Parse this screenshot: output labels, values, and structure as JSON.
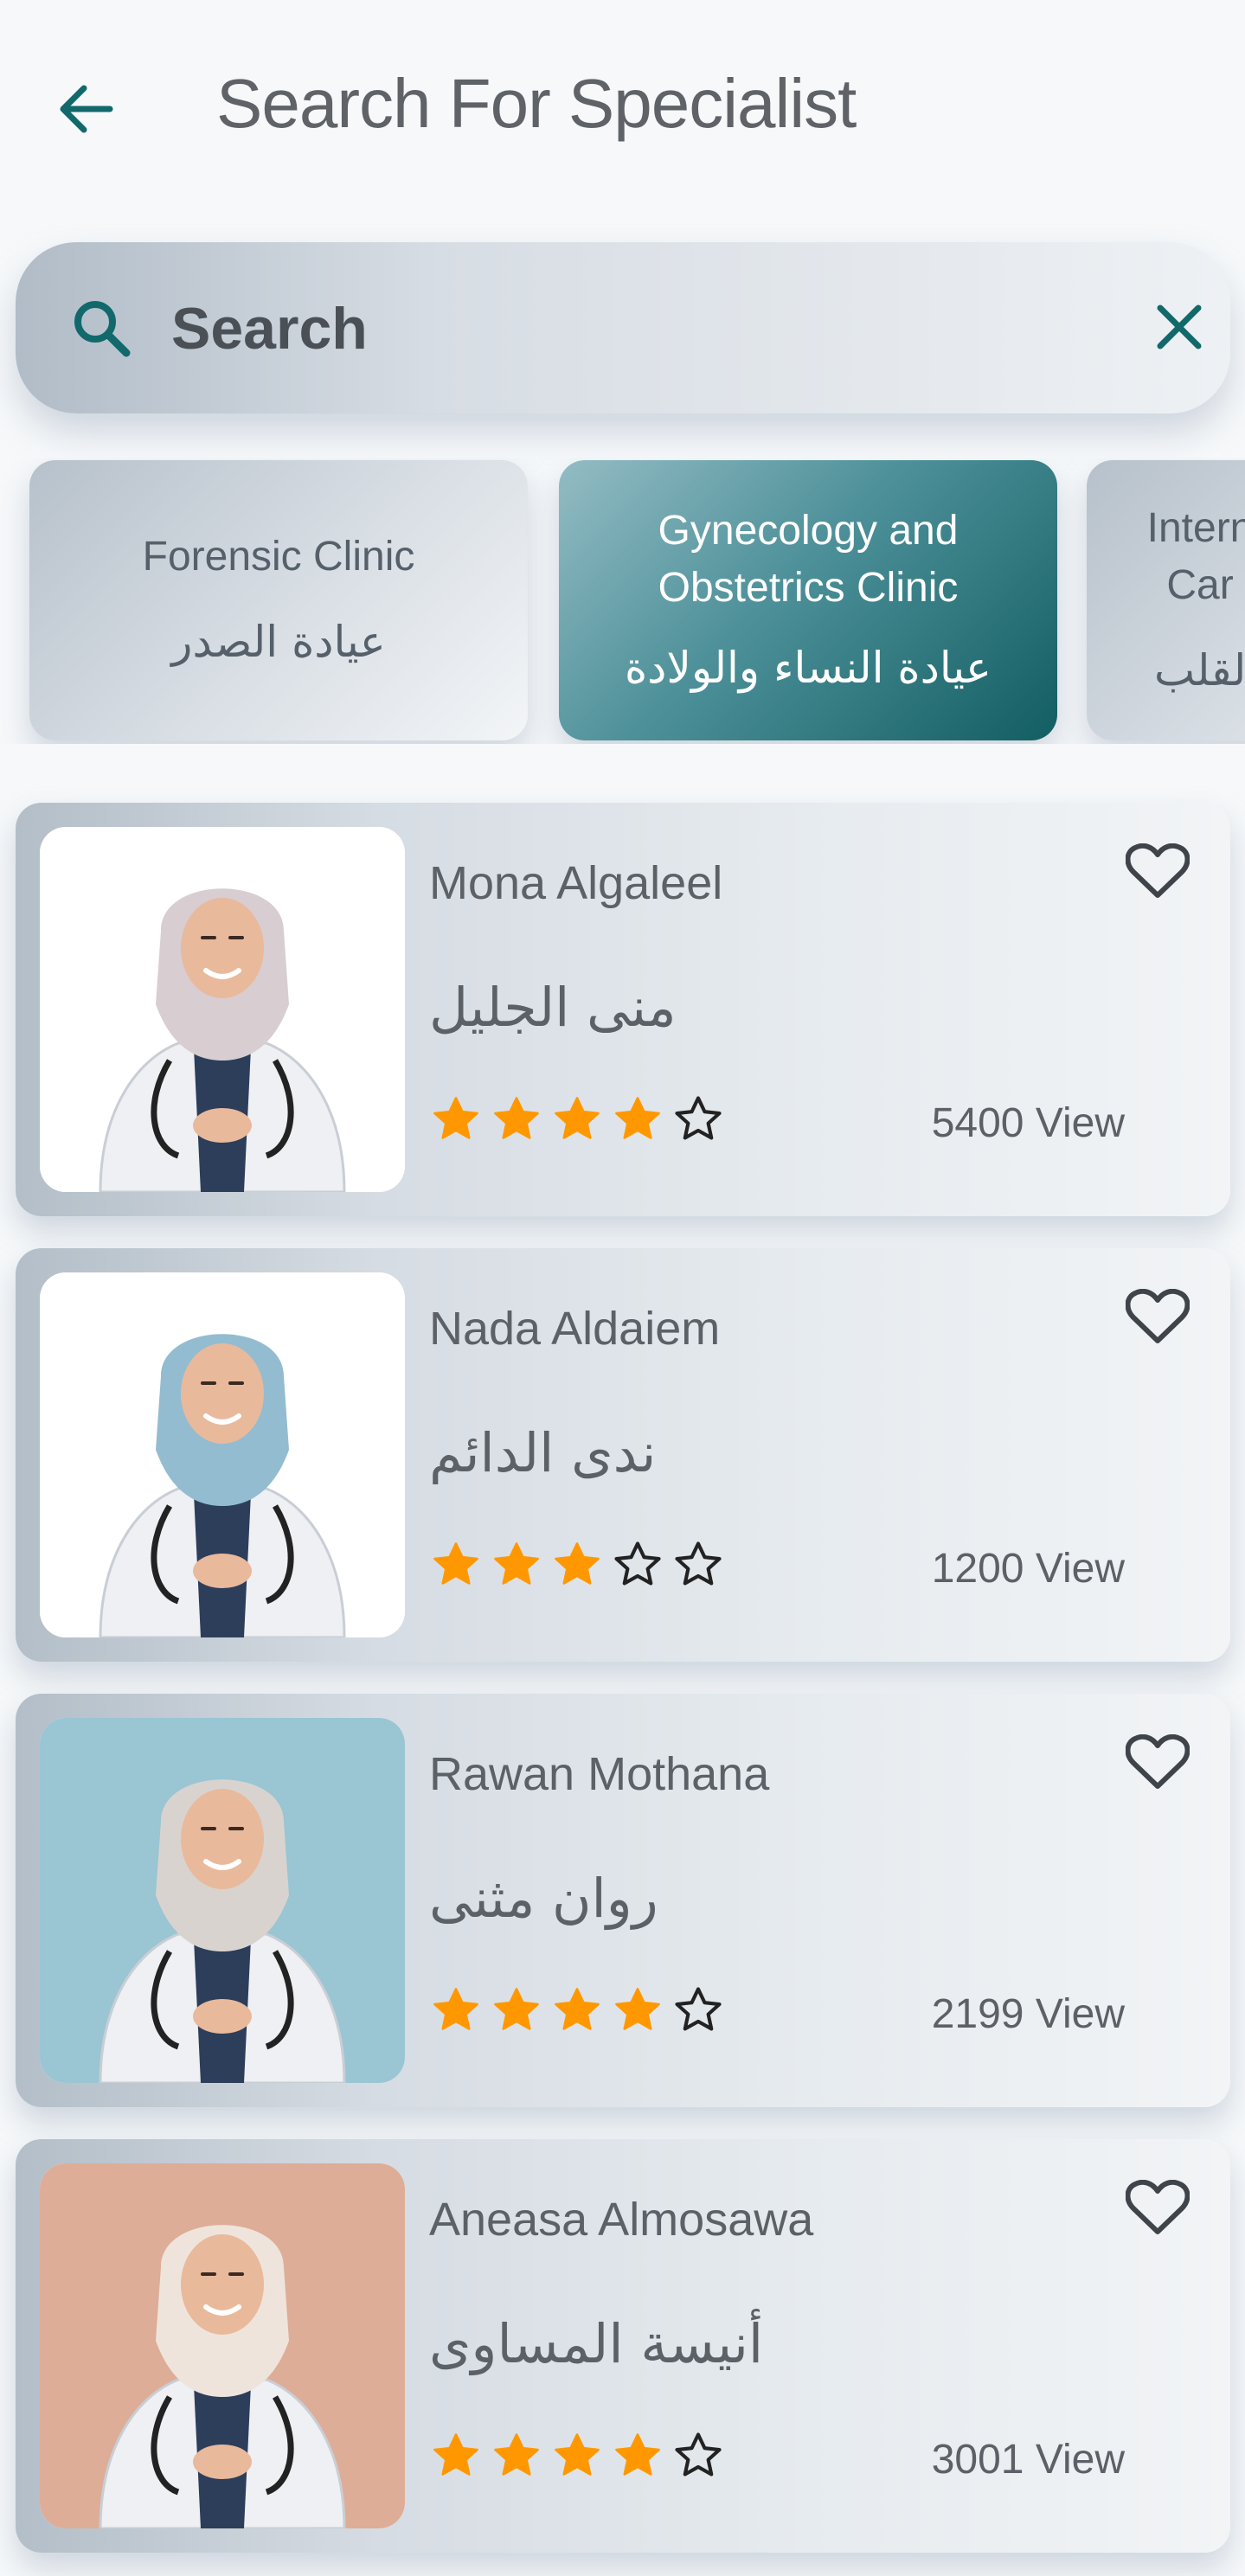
{
  "header": {
    "title": "Search For Specialist",
    "back_icon": "arrow-left-icon"
  },
  "search": {
    "placeholder": "Search",
    "value": "",
    "icon": "search-icon",
    "clear_icon": "close-icon"
  },
  "categories": [
    {
      "en": "Forensic Clinic",
      "ar": "عيادة الصدر",
      "selected": false
    },
    {
      "en": "Gynecology and Obstetrics Clinic",
      "ar": "عيادة النساء والولادة",
      "selected": true
    },
    {
      "en": "Intern Car",
      "ar": "القلب",
      "selected": false
    }
  ],
  "doctors": [
    {
      "name": "Mona Algaleel",
      "name_ar": "منى الجليل",
      "rating": 4,
      "max_rating": 5,
      "views": "5400 View",
      "photo_bg": "#ffffff",
      "hijab": "#d8cdd1"
    },
    {
      "name": "Nada Aldaiem",
      "name_ar": "ندى الدائم",
      "rating": 3,
      "max_rating": 5,
      "views": "1200 View",
      "photo_bg": "#ffffff",
      "hijab": "#93bcd1"
    },
    {
      "name": "Rawan Mothana",
      "name_ar": "روان مثنى",
      "rating": 4,
      "max_rating": 5,
      "views": "2199 View",
      "photo_bg": "#9ac5d3",
      "hijab": "#d9d3cf"
    },
    {
      "name": "Aneasa Almosawa",
      "name_ar": "أنيسة المساوى",
      "rating": 4,
      "max_rating": 5,
      "views": "3001 View",
      "photo_bg": "#ddad97",
      "hijab": "#efe4dc"
    }
  ],
  "colors": {
    "accent": "#12696b",
    "star_filled": "#ff9800",
    "text": "#5b6167"
  }
}
